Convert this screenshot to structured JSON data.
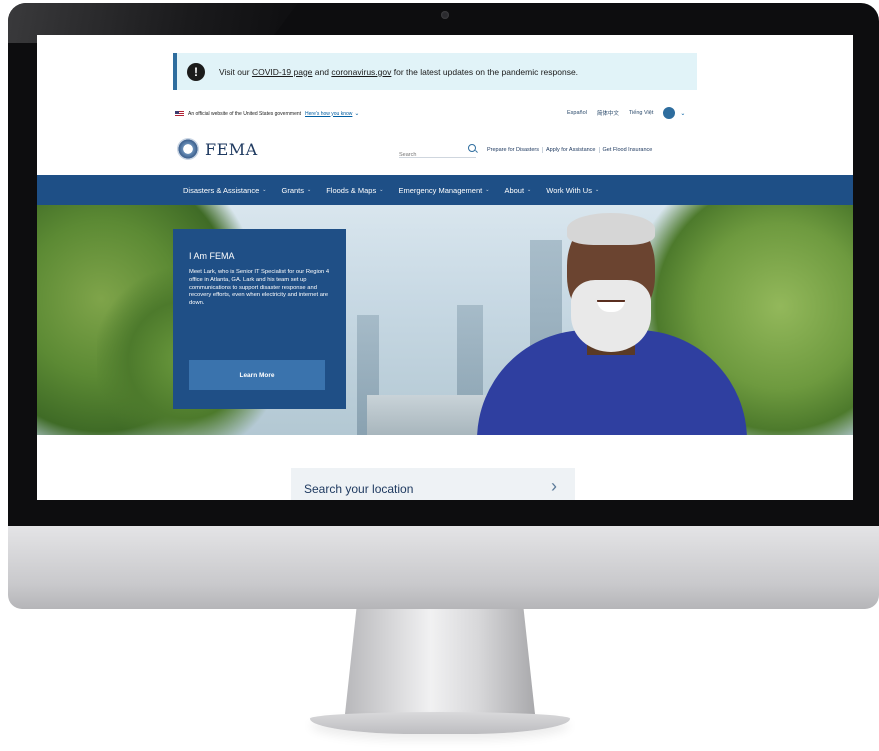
{
  "alert": {
    "prefix": "Visit our",
    "covid_link": "COVID-19 page",
    "middle": "and",
    "gov_link": "coronavirus.gov",
    "suffix": "for the latest updates on the pandemic response."
  },
  "gov_banner": {
    "text": "An official website of the United States government",
    "link": "Here's how you know"
  },
  "languages": [
    "Español",
    "简体中文",
    "Tiếng Việt"
  ],
  "logo": {
    "text": "FEMA"
  },
  "search": {
    "placeholder": "Search"
  },
  "util_links": [
    "Prepare for Disasters",
    "Apply for Assistance",
    "Get Flood Insurance"
  ],
  "nav": [
    "Disasters & Assistance",
    "Grants",
    "Floods & Maps",
    "Emergency Management",
    "About",
    "Work With Us"
  ],
  "hero": {
    "title": "I Am FEMA",
    "body": "Meet Lark, who is Senior IT Specialist for our Region 4 office in Atlanta, GA. Lark and his team set up communications to support disaster response and recovery efforts, even when electricity and internet are down.",
    "button": "Learn More"
  },
  "location_search": {
    "label": "Search your location"
  }
}
